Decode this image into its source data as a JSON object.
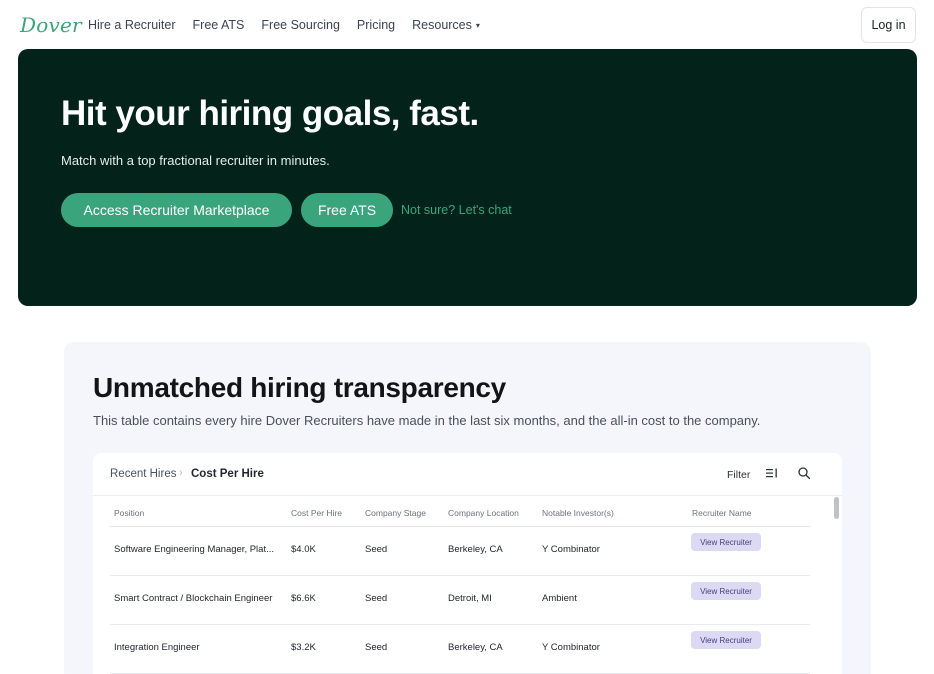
{
  "nav": {
    "logo": "Dover",
    "links": [
      "Hire a Recruiter",
      "Free ATS",
      "Free Sourcing",
      "Pricing",
      "Resources"
    ],
    "resources_caret": "▾",
    "login_label": "Log in"
  },
  "hero": {
    "title": "Hit your hiring goals, fast.",
    "subtitle": "Match with a top fractional recruiter in minutes.",
    "primary_button": "Access Recruiter Marketplace",
    "secondary_button": "Free ATS",
    "chat_link": "Not sure? Let's chat",
    "background_color": "#02221a",
    "accent_color": "#3aa57d"
  },
  "transparency": {
    "title": "Unmatched hiring transparency",
    "description": "This table contains every hire Dover Recruiters have made in the last six months, and the all-in cost to the company.",
    "table": {
      "breadcrumb_parent": "Recent Hires",
      "breadcrumb_current": "Cost Per Hire",
      "filter_label": "Filter",
      "columns": [
        "Position",
        "Cost Per Hire",
        "Company Stage",
        "Company Location",
        "Notable Investor(s)",
        "Recruiter Name"
      ],
      "rows": [
        {
          "position": "Software Engineering Manager, Plat...",
          "cost": "$4.0K",
          "stage": "Seed",
          "location": "Berkeley, CA",
          "investor": "Y Combinator",
          "recruiter": "View Recruiter"
        },
        {
          "position": "Smart Contract / Blockchain Engineer",
          "cost": "$6.6K",
          "stage": "Seed",
          "location": "Detroit, MI",
          "investor": "Ambient",
          "recruiter": "View Recruiter"
        },
        {
          "position": "Integration Engineer",
          "cost": "$3.2K",
          "stage": "Seed",
          "location": "Berkeley, CA",
          "investor": "Y Combinator",
          "recruiter": "View Recruiter"
        }
      ]
    }
  },
  "icons": {
    "breadcrumb_separator": "chevron-right-icon",
    "columns_toggle": "columns-icon",
    "search": "search-icon"
  }
}
